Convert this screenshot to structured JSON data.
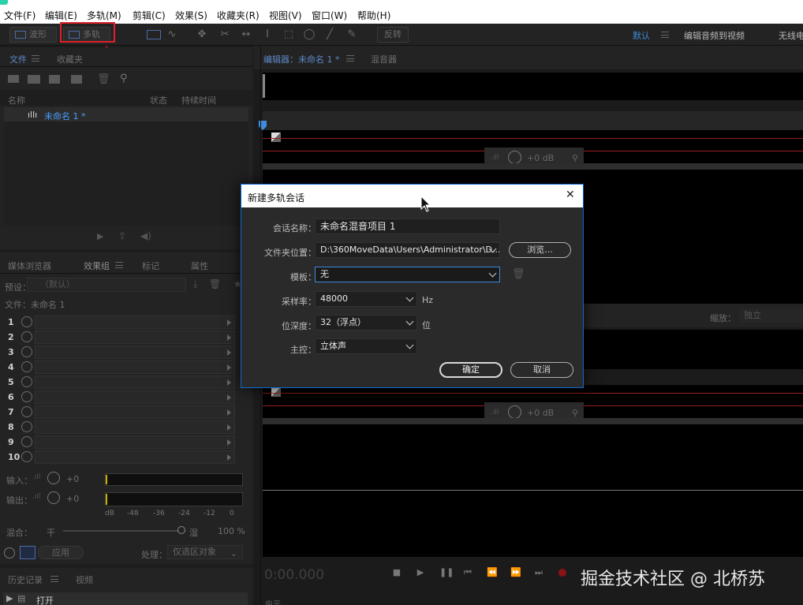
{
  "menu": [
    "文件(F)",
    "编辑(E)",
    "多轨(M)",
    "剪辑(C)",
    "效果(S)",
    "收藏夹(R)",
    "视图(V)",
    "窗口(W)",
    "帮助(H)"
  ],
  "toolbar": {
    "waveform_label": "波形",
    "multitrack_label": "多轨",
    "skip_label": "反转",
    "workspace_default": "默认",
    "workspace_video": "编辑音频到视频",
    "workspace_wireless": "无线电"
  },
  "files_panel": {
    "tab_files": "文件",
    "tab_favorites": "收藏夹",
    "col_name": "名称",
    "col_status": "状态",
    "col_duration": "持续时间",
    "item": "未命名 1 *"
  },
  "effects_panel": {
    "tab_media": "媒体浏览器",
    "tab_effects": "效果组",
    "tab_markers": "标记",
    "tab_props": "属性",
    "preset_label": "预设：",
    "preset_value": "（默认）",
    "file_label": "文件：未命名 1",
    "rows": [
      "1",
      "2",
      "3",
      "4",
      "5",
      "6",
      "7",
      "8",
      "9",
      "10"
    ],
    "input_label": "输入：",
    "input_value": "+0",
    "output_label": "输出：",
    "output_value": "+0",
    "meter_ticks": [
      "dB",
      "-48",
      "-36",
      "-24",
      "-12",
      "0"
    ],
    "mix_label": "混合：",
    "mix_dry": "干",
    "mix_wet": "湿",
    "mix_pct": "100 %",
    "apply_label": "应用",
    "process_label": "处理：",
    "process_value": "仅选区对象"
  },
  "history_panel": {
    "tab_history": "历史记录",
    "tab_video": "视频",
    "item": "打开"
  },
  "editor": {
    "tab_editor": "编辑器：未命名 1 *",
    "tab_mixer": "混音器",
    "track_db_1": "+0 dB",
    "track_db_2": "+0 dB",
    "zoom_label": "缩放：",
    "zoom_value": "独立",
    "timecode": "0:00.000",
    "level_label": "电平"
  },
  "dialog": {
    "title": "新建多轨会话",
    "session_label": "会话名称：",
    "session_value": "未命名混音项目 1",
    "folder_label": "文件夹位置：",
    "folder_value": "D:\\360MoveData\\Users\\Administrator\\D...",
    "browse_label": "浏览...",
    "template_label": "模板：",
    "template_value": "无",
    "rate_label": "采样率：",
    "rate_value": "48000",
    "rate_unit": "Hz",
    "depth_label": "位深度：",
    "depth_value": "32（浮点）",
    "depth_unit": "位",
    "master_label": "主控：",
    "master_value": "立体声",
    "ok_label": "确定",
    "cancel_label": "取消"
  },
  "watermark": "掘金技术社区 @ 北桥苏",
  "colors": {
    "accent_blue": "#0e6ad0",
    "highlight_red": "#e0202a",
    "file_item_blue": "#4a9eff"
  }
}
